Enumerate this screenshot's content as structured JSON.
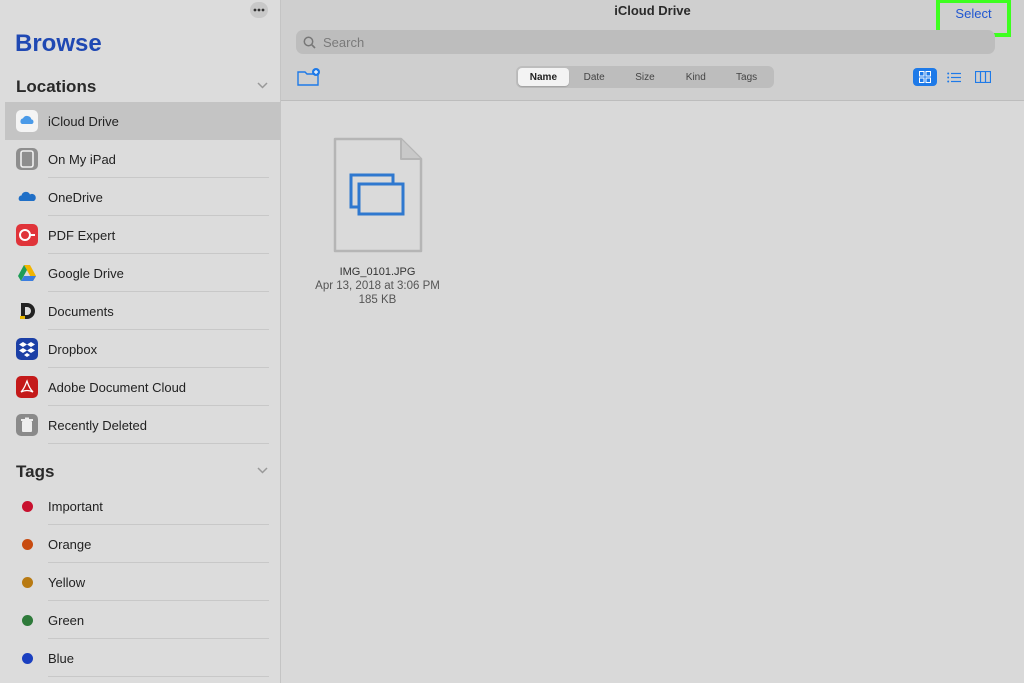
{
  "sidebar": {
    "title": "Browse",
    "locations_header": "Locations",
    "locations": [
      {
        "label": "iCloud Drive",
        "icon": "icloud-icon",
        "selected": true
      },
      {
        "label": "On My iPad",
        "icon": "ipad-icon"
      },
      {
        "label": "OneDrive",
        "icon": "onedrive-icon"
      },
      {
        "label": "PDF Expert",
        "icon": "pdf-expert-icon"
      },
      {
        "label": "Google Drive",
        "icon": "google-drive-icon"
      },
      {
        "label": "Documents",
        "icon": "documents-icon"
      },
      {
        "label": "Dropbox",
        "icon": "dropbox-icon"
      },
      {
        "label": "Adobe Document Cloud",
        "icon": "adobe-icon"
      },
      {
        "label": "Recently Deleted",
        "icon": "trash-icon"
      }
    ],
    "tags_header": "Tags",
    "tags": [
      {
        "label": "Important",
        "color": "#c8102e"
      },
      {
        "label": "Orange",
        "color": "#c84b10"
      },
      {
        "label": "Yellow",
        "color": "#b87a12"
      },
      {
        "label": "Green",
        "color": "#2e7a3a"
      },
      {
        "label": "Blue",
        "color": "#1a3fc0"
      }
    ]
  },
  "header": {
    "title": "iCloud Drive",
    "select_label": "Select",
    "search_placeholder": "Search",
    "sort_tabs": [
      "Name",
      "Date",
      "Size",
      "Kind",
      "Tags"
    ],
    "active_sort": "Name",
    "accent": "#1e7ae8",
    "highlight": "#3dff1f"
  },
  "files": [
    {
      "name": "IMG_0101.JPG",
      "date": "Apr 13, 2018 at 3:06 PM",
      "size": "185 KB"
    }
  ]
}
